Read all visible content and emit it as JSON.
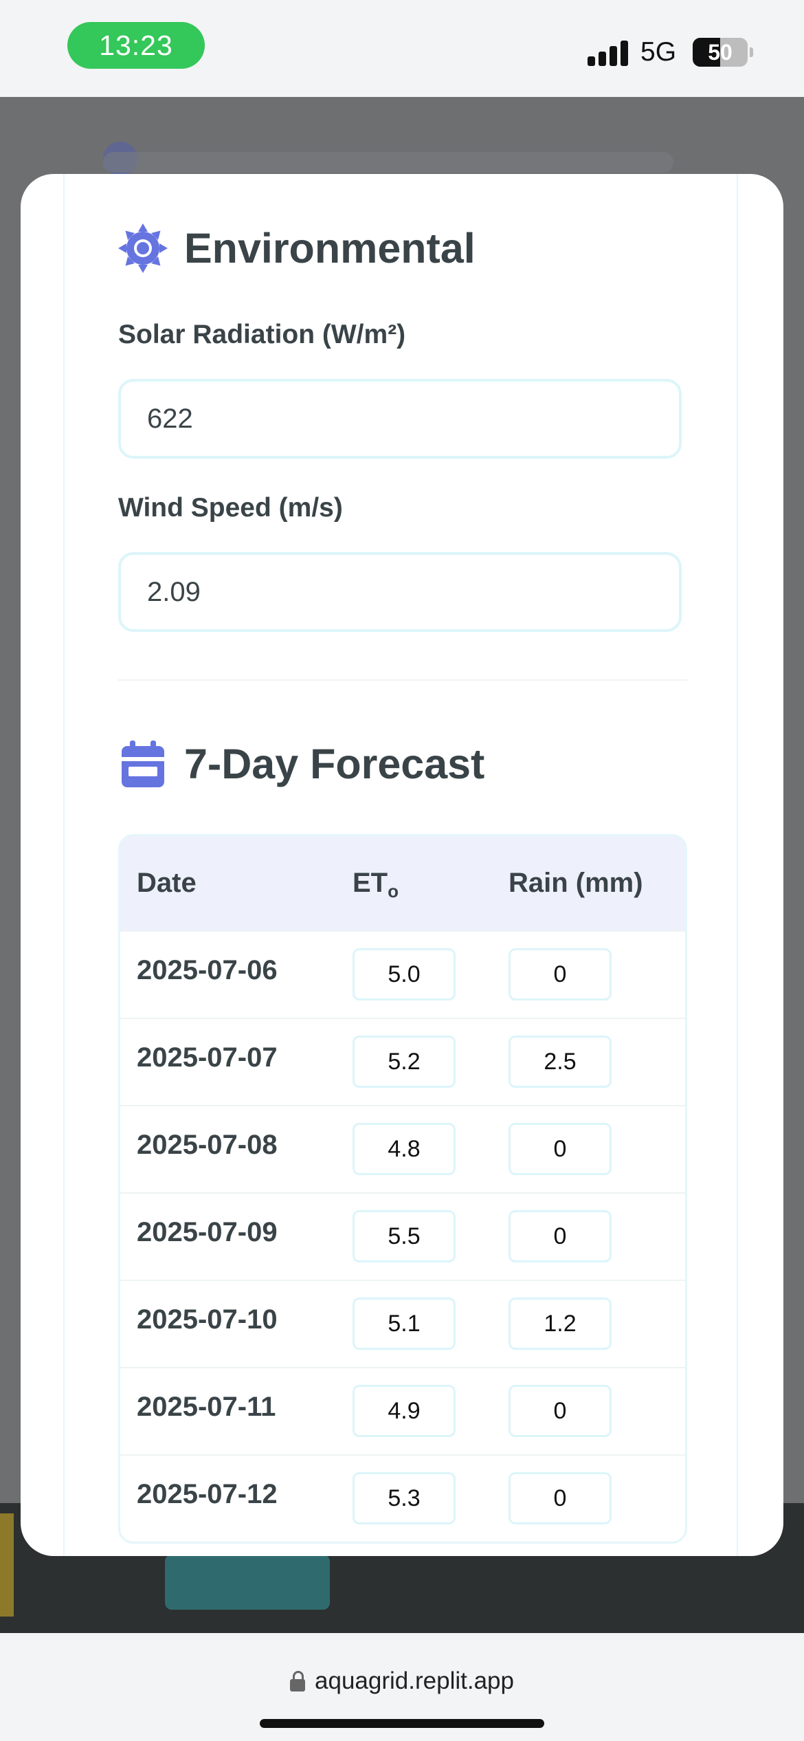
{
  "status_bar": {
    "time": "13:23",
    "network": "5G",
    "battery": "50",
    "battery_level": 0.5,
    "signal_icon": "signal-bars-icon"
  },
  "environmental": {
    "title": "Environmental",
    "icon": "sun-icon",
    "solar_label": "Solar Radiation (W/m²)",
    "solar_value": "622",
    "wind_label": "Wind Speed (m/s)",
    "wind_value": "2.09"
  },
  "forecast": {
    "title": "7-Day Forecast",
    "icon": "calendar-icon",
    "headers": {
      "date": "Date",
      "et": "ET",
      "et_sub": "o",
      "rain": "Rain (mm)"
    },
    "rows": [
      {
        "date": "2025-07-06",
        "et": "5.0",
        "rain": "0"
      },
      {
        "date": "2025-07-07",
        "et": "5.2",
        "rain": "2.5"
      },
      {
        "date": "2025-07-08",
        "et": "4.8",
        "rain": "0"
      },
      {
        "date": "2025-07-09",
        "et": "5.5",
        "rain": "0"
      },
      {
        "date": "2025-07-10",
        "et": "5.1",
        "rain": "1.2"
      },
      {
        "date": "2025-07-11",
        "et": "4.9",
        "rain": "0"
      },
      {
        "date": "2025-07-12",
        "et": "5.3",
        "rain": "0"
      }
    ]
  },
  "browser": {
    "url": "aquagrid.replit.app"
  },
  "colors": {
    "accent": "#6674e0",
    "text": "#3a4448",
    "input_border": "#dcf5fa",
    "table_header_bg": "#eef0fc",
    "time_pill": "#34c759"
  }
}
